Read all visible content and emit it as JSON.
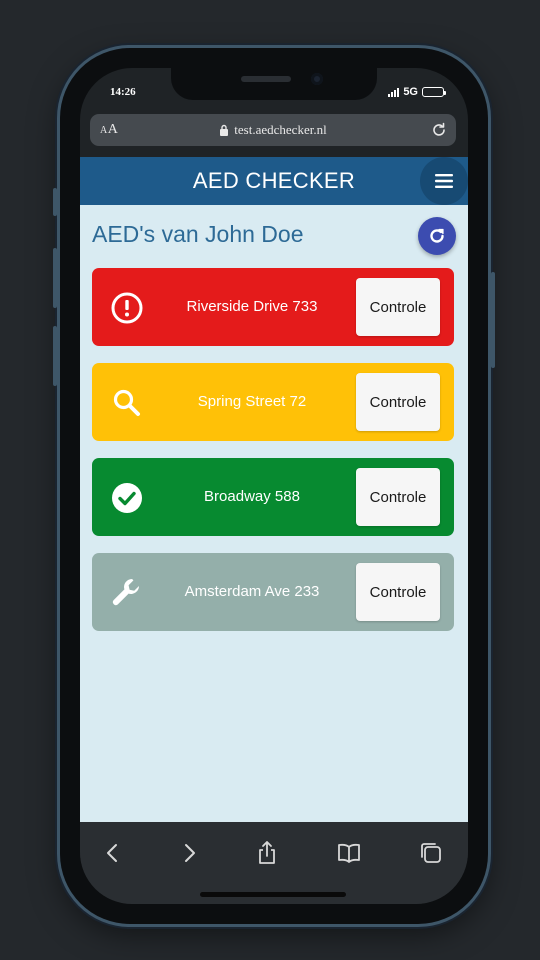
{
  "status_bar": {
    "time": "14:26",
    "network": "5G"
  },
  "browser": {
    "text_size_small": "A",
    "text_size_large": "A",
    "url": "test.aedchecker.nl",
    "icons": [
      "lock-icon",
      "reload-icon",
      "back-icon",
      "forward-icon",
      "share-icon",
      "bookmarks-icon",
      "tabs-icon"
    ]
  },
  "header": {
    "title": "AED CHECKER",
    "menu_icon": "hamburger-menu-icon"
  },
  "page": {
    "heading": "AED's van John Doe",
    "refresh_icon": "refresh-icon"
  },
  "aeds": [
    {
      "address": "Riverside Drive 733",
      "button": "Controle",
      "status_icon": "alert-icon",
      "color": "#e41b1b"
    },
    {
      "address": "Spring Street 72",
      "button": "Controle",
      "status_icon": "search-icon",
      "color": "#ffc107"
    },
    {
      "address": "Broadway 588",
      "button": "Controle",
      "status_icon": "check-circle-icon",
      "color": "#078a30"
    },
    {
      "address": "Amsterdam Ave 233",
      "button": "Controle",
      "status_icon": "wrench-icon",
      "color": "#94afaa"
    }
  ],
  "colors": {
    "header": "#1e5a8a",
    "background": "#d9ebf2",
    "heading_text": "#2d6a96",
    "refresh_button": "#3c4cb0"
  }
}
